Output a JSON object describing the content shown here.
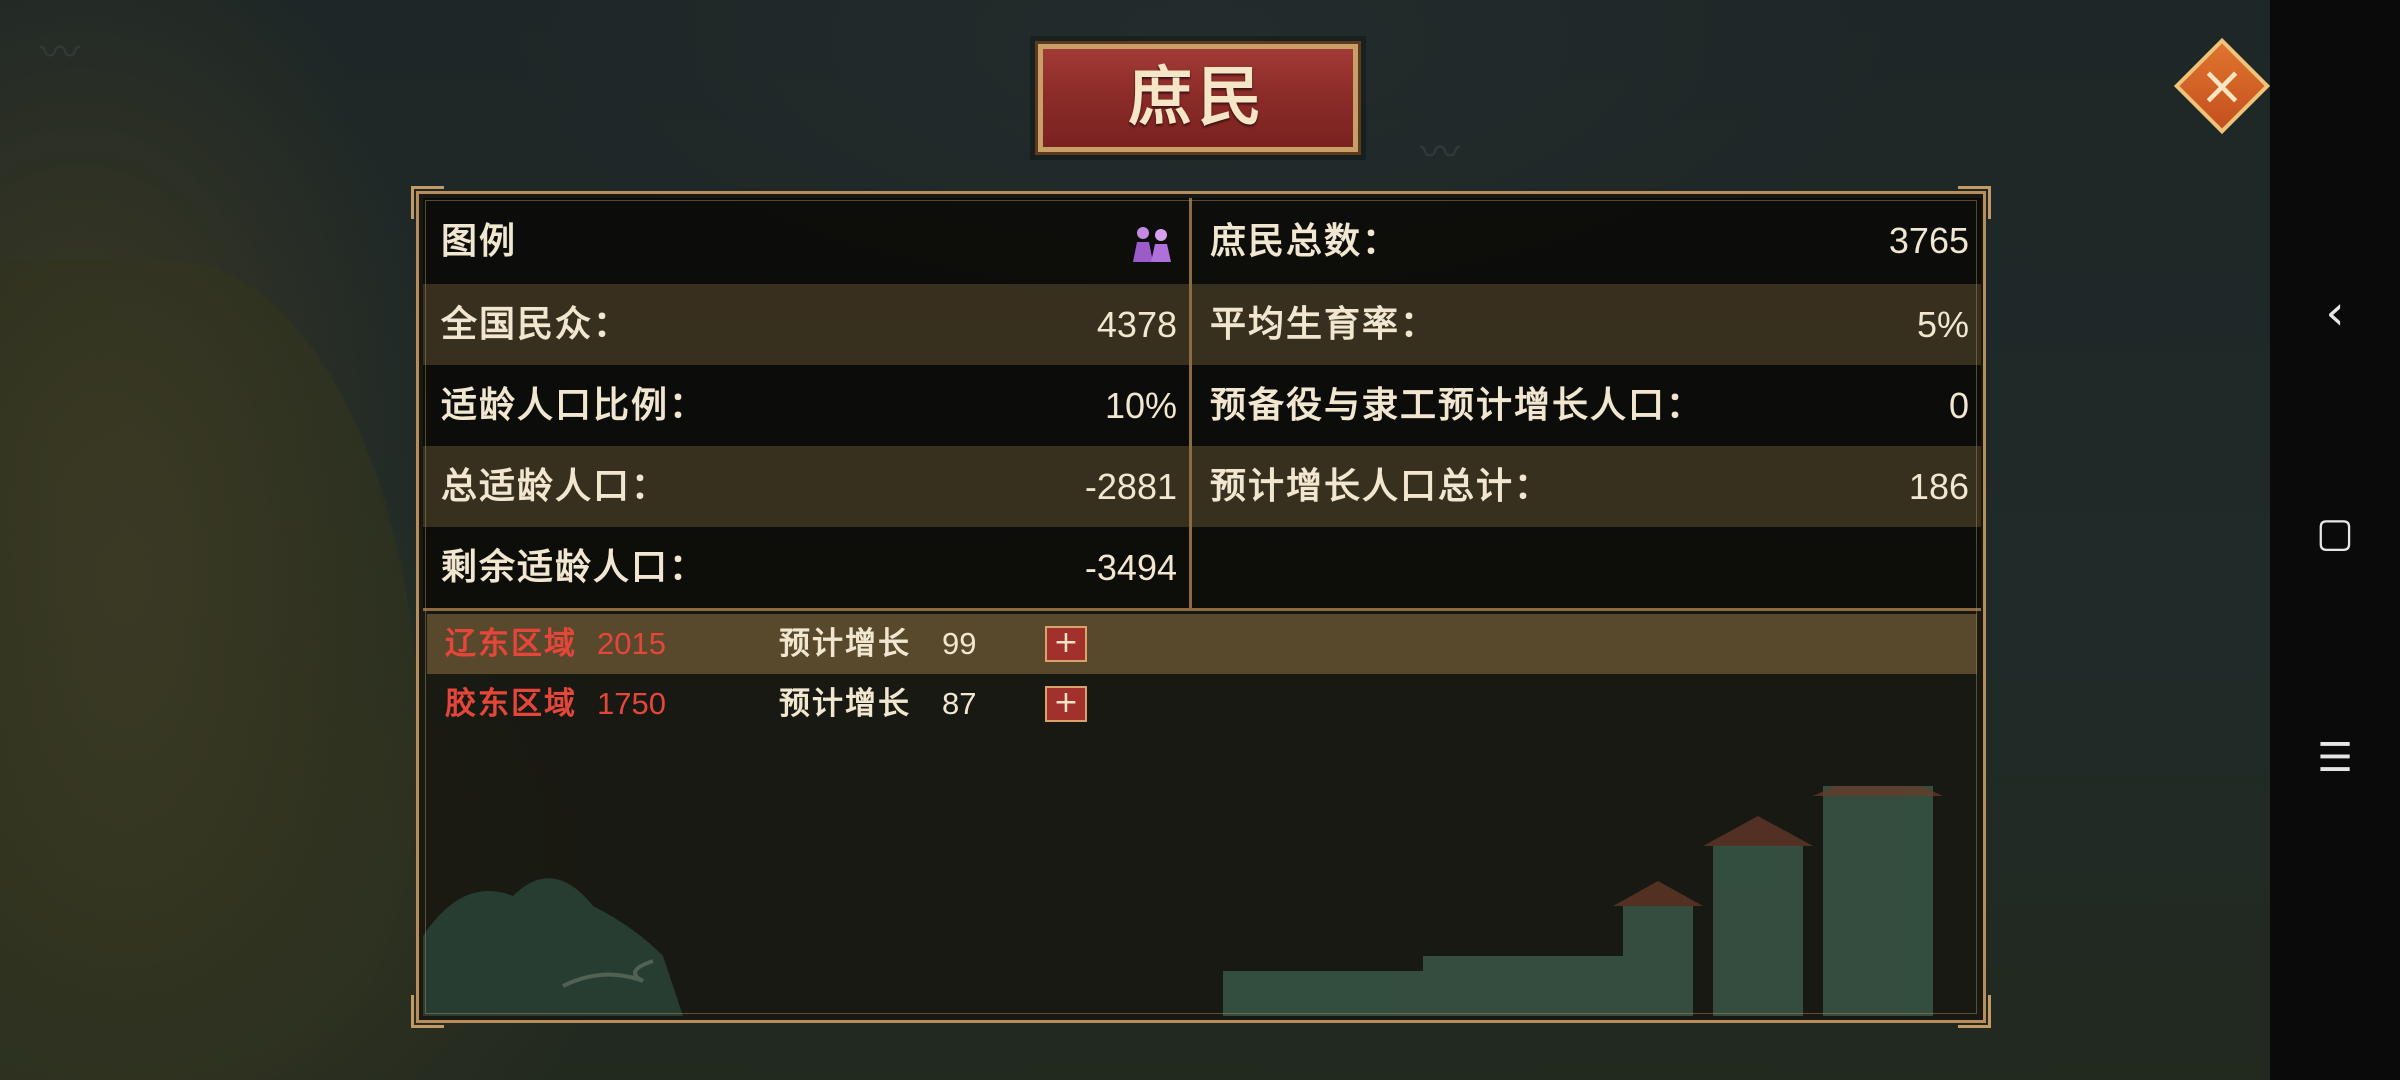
{
  "title": "庶民",
  "close_icon": "close-icon",
  "left_stats": [
    {
      "label": "图例",
      "value": "",
      "icon": "commoners-legend-icon"
    },
    {
      "label": "全国民众：",
      "value": "4378"
    },
    {
      "label": "适龄人口比例：",
      "value": "10%"
    },
    {
      "label": "总适龄人口：",
      "value": "-2881"
    },
    {
      "label": "剩余适龄人口：",
      "value": "-3494"
    }
  ],
  "right_stats": [
    {
      "label": "庶民总数：",
      "value": "3765"
    },
    {
      "label": "平均生育率：",
      "value": "5%"
    },
    {
      "label": "预备役与隶工预计增长人口：",
      "value": "0"
    },
    {
      "label": "预计增长人口总计：",
      "value": "186"
    }
  ],
  "regions": [
    {
      "name": "辽东区域",
      "count": "2015",
      "growth_label": "预计增长",
      "growth": "99",
      "plus": "+"
    },
    {
      "name": "胶东区域",
      "count": "1750",
      "growth_label": "预计增长",
      "growth": "87",
      "plus": "+"
    }
  ],
  "nav": {
    "back": "‹",
    "home": "▢",
    "menu": "☰"
  },
  "colors": {
    "accent_red": "#e5463a",
    "gold_border": "#b78e5b",
    "plaque_red": "#8a2b28"
  }
}
